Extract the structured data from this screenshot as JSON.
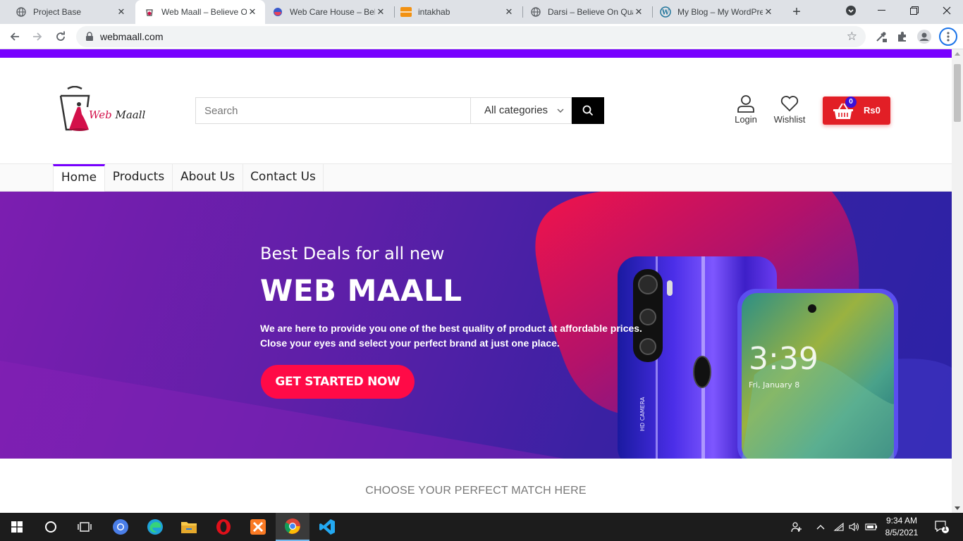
{
  "browser": {
    "tabs": [
      {
        "title": "Project Base",
        "icon": "globe-icon"
      },
      {
        "title": "Web Maall – Believe On Quality",
        "icon": "webmaall-favicon"
      },
      {
        "title": "Web Care House – Believe",
        "icon": "webcare-favicon"
      },
      {
        "title": "intakhab",
        "icon": "orange-favicon"
      },
      {
        "title": "Darsi – Believe On Quality",
        "icon": "globe-icon"
      },
      {
        "title": "My Blog – My WordPress",
        "icon": "wordpress-icon"
      }
    ],
    "url": "webmaall.com"
  },
  "header": {
    "logo_word1": "Web",
    "logo_word2": "Maall",
    "search_placeholder": "Search",
    "category_selected": "All categories",
    "login_label": "Login",
    "wishlist_label": "Wishlist",
    "cart_count": "0",
    "cart_amount": "Rs0"
  },
  "menu": {
    "items": [
      "Home",
      "Products",
      "About Us",
      "Contact Us"
    ],
    "active": "Home"
  },
  "hero": {
    "subtitle": "Best Deals for all new",
    "title": "WEB MAALL",
    "line1": "We are here to provide you one of the best quality of product at affordable prices.",
    "line2": "Close your eyes and select your perfect brand at just one place.",
    "cta": "GET STARTED NOW",
    "phone_clock": "3:39",
    "phone_date": "Fri, January 8",
    "phone_label": "HD CAMERA"
  },
  "section": {
    "heading": "CHOOSE YOUR PERFECT MATCH HERE"
  },
  "taskbar": {
    "time": "9:34 AM",
    "date": "8/5/2021",
    "notification_count": "1"
  },
  "colors": {
    "brand_purple": "#7700ff",
    "cta_red": "#ff0a47",
    "cart_red": "#e21f26"
  }
}
